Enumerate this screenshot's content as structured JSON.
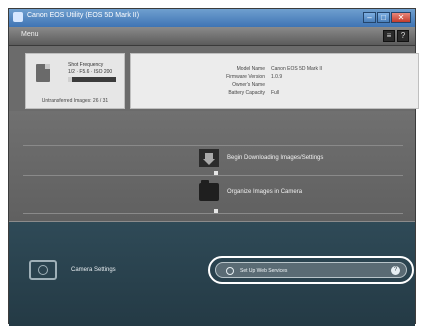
{
  "window": {
    "title": "Canon EOS Utility (EOS 5D Mark II)",
    "controls": {
      "minimize": "–",
      "maximize": "□",
      "close": "✕"
    }
  },
  "header": {
    "menu_label": "Menu",
    "buttons": {
      "preferences": "≡",
      "help": "?"
    }
  },
  "camera_card": {
    "label": "Shot Frequency",
    "value": "1/2  ·  F5.6  ·  ISO 200",
    "progress_fraction": 0.08,
    "footer": "Untransferred Images: 26 / 31"
  },
  "camera_info": [
    {
      "key": "Model Name",
      "value": "Canon EOS 5D Mark II"
    },
    {
      "key": "Firmware Version",
      "value": "1.0.9"
    },
    {
      "key": "Owner's Name",
      "value": ""
    },
    {
      "key": "Battery Capacity",
      "value": "Full"
    }
  ],
  "actions": [
    {
      "id": "download",
      "label": "Begin Downloading Images/Settings"
    },
    {
      "id": "organize",
      "label": "Organize Images in Camera"
    }
  ],
  "bottom": {
    "section_label": "Camera Settings",
    "cta_label": "Set Up Web Services",
    "cta_help": "?"
  },
  "colors": {
    "titlebar": "#3f74b4",
    "body_gray": "#6b6b6b",
    "bottom_panel": "#2f4a57",
    "highlight": "#ffffff"
  }
}
